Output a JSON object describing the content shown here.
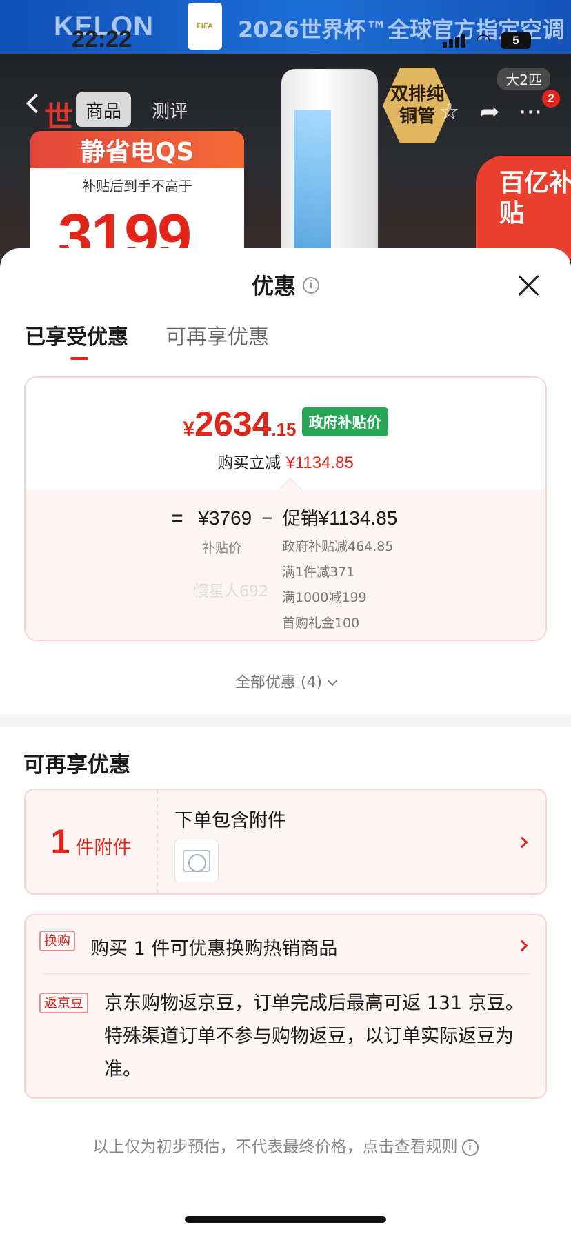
{
  "background": {
    "brand": "KELON",
    "badge": "FIFA",
    "slogan": "2026世界杯™全球官方指定空调",
    "status_time": "22:22",
    "battery": "5",
    "tabs": [
      "商品",
      "测评"
    ],
    "season": "世",
    "promo_ribbon": "静省电QS",
    "promo_sub": "补贴后到手不高于",
    "promo_price": "3199",
    "copper_badge": "双排纯铜管",
    "size_tag": "大2匹",
    "cart_count": "2",
    "subsidy_corner": "百亿补贴"
  },
  "sheet": {
    "title": "优惠",
    "info_icon": "i",
    "tabs": [
      {
        "label": "已享受优惠",
        "active": true
      },
      {
        "label": "可再享优惠",
        "active": false
      }
    ]
  },
  "price_card": {
    "currency": "¥",
    "price_int": "2634",
    "price_dec": ".15",
    "badge": "政府补贴价",
    "instant_label": "购买立减",
    "instant_value": "¥1134.85",
    "formula_eq": "=",
    "base_price": "¥3769",
    "minus": "−",
    "promo_label": "促销",
    "promo_total": "¥1134.85",
    "base_label": "补贴价",
    "details": [
      "政府补贴减464.85",
      "满1件减371",
      "满1000减199",
      "首购礼金100"
    ],
    "watermark": "慢星人692"
  },
  "all_promos": "全部优惠 (4)",
  "more_section": {
    "title": "可再享优惠",
    "accessory": {
      "count": "1",
      "unit": "件附件",
      "title": "下单包含附件"
    },
    "exchange": {
      "tag": "换购",
      "text": "购买 1 件可优惠换购热销商品"
    },
    "beans": {
      "tag": "返京豆",
      "text": "京东购物返京豆，订单完成后最高可返 131 京豆。特殊渠道订单不参与购物返豆，以订单实际返豆为准。"
    }
  },
  "footnote": "以上仅为初步预估，不代表最终价格，点击查看规则",
  "colors": {
    "accent_red": "#e1251b",
    "gov_green": "#25a755",
    "card_border": "#f9d4d4",
    "card_fill": "#fdf4f4"
  }
}
